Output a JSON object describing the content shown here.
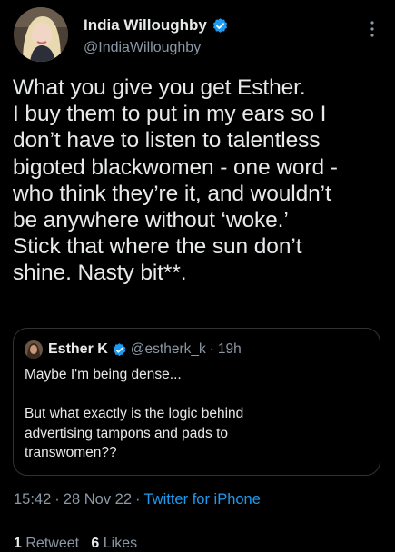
{
  "author": {
    "display_name": "India Willoughby",
    "handle": "@IndiaWilloughby",
    "verified": true,
    "avatar": "user-avatar-photo"
  },
  "tweet": {
    "text": "What you give you get Esther.\nI buy them to put in my ears so I\ndon’t have to listen to talentless\nbigoted blackwomen - one word -\nwho think they’re it, and wouldn’t\nbe anywhere without ‘woke.’\nStick that where the sun don’t\nshine. Nasty bit**.",
    "time": "15:42",
    "date": "28 Nov 22",
    "source": "Twitter for iPhone"
  },
  "quoted_tweet": {
    "display_name": "Esther K",
    "handle": "@estherk_k",
    "time_ago": "19h",
    "verified": true,
    "text": "Maybe I'm being dense...\n\nBut what exactly is the logic behind\nadvertising tampons and pads to\ntranswomen??"
  },
  "stats": {
    "retweets_count": "1",
    "retweets_label": "Retweet",
    "likes_count": "6",
    "likes_label": "Likes"
  },
  "colors": {
    "background": "#000000",
    "primary_text": "#e7e9ea",
    "secondary_text": "#8b98a5",
    "accent": "#1d9bf0",
    "border": "#2f3336"
  },
  "icons": {
    "verified": "verified-badge-icon",
    "more": "more-vertical-icon"
  }
}
